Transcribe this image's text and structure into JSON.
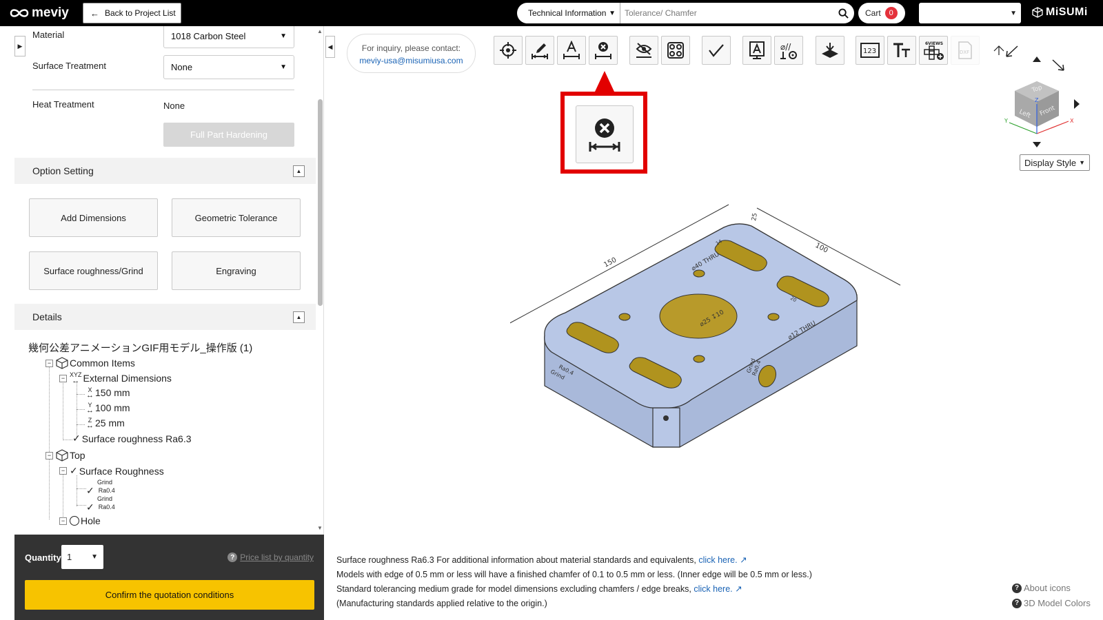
{
  "header": {
    "logo_text": "meviy",
    "back_label": "Back to Project List",
    "search_category": "Technical Information",
    "search_placeholder": "Tolerance/ Chamfer",
    "cart_label": "Cart",
    "cart_count": "0",
    "language_value": "",
    "brand": "MiSUMi"
  },
  "left_panel": {
    "material_label": "Material",
    "material_value": "1018 Carbon Steel",
    "surface_treatment_label": "Surface Treatment",
    "surface_treatment_value": "None",
    "heat_treatment_label": "Heat Treatment",
    "heat_treatment_value": "None",
    "full_part_hardening_label": "Full Part Hardening",
    "option_setting_title": "Option Setting",
    "option_buttons": [
      "Add Dimensions",
      "Geometric Tolerance",
      "Surface roughness/Grind",
      "Engraving"
    ],
    "details_title": "Details",
    "tree": {
      "root": "幾何公差アニメーションGIF用モデル_操作版 (1)",
      "common_items": "Common Items",
      "external_dimensions": "External Dimensions",
      "xyz_tag": "XYZ",
      "dim_x_axis": "X",
      "dim_x": "150 mm",
      "dim_y_axis": "Y",
      "dim_y": "100 mm",
      "dim_z_axis": "Z",
      "dim_z": "25 mm",
      "surface_roughness_common": "Surface roughness Ra6.3",
      "top": "Top",
      "surface_roughness": "Surface Roughness",
      "grind_1": "Grind",
      "ra_1": "Ra0.4",
      "grind_2": "Grind",
      "ra_2": "Ra0.4",
      "hole": "Hole"
    }
  },
  "bottom_left": {
    "quantity_label": "Quantity",
    "quantity_value": "1",
    "price_link": "Price list by quantity",
    "confirm_label": "Confirm the quotation conditions"
  },
  "viewer": {
    "contact_line1": "For inquiry, please contact:",
    "contact_email": "meviy-usa@misumiusa.com",
    "toolbar_icons": [
      "center-fit-icon",
      "edit-dimension-icon",
      "text-dimension-icon",
      "delete-dimension-icon",
      "hide-icon",
      "features-icon",
      "roughness-icon",
      "text-box-icon",
      "hole-tolerance-icon",
      "surface-icon",
      "numbering-icon",
      "text-size-icon",
      "six-views-icon",
      "dxf-icon"
    ],
    "six_views_label": "6VIEWS",
    "dxf_label": "DXF",
    "display_style_label": "Display Style",
    "cube_faces": [
      "Top",
      "Left",
      "Front"
    ],
    "axis_labels": [
      "X",
      "Y",
      "Z"
    ],
    "model_labels": {
      "dim_150": "150",
      "dim_100": "100",
      "dim_25": "25",
      "slot_len": "14",
      "slot_w": "20",
      "hole_40": "⌀40 THRU",
      "hole_12": "⌀12 THRU",
      "hole_center": "⌀25 ↧10",
      "grind_left": "Grind",
      "ra_left": "Ra0.4",
      "grind_right": "Grind",
      "ra_right": "Ra0.4"
    }
  },
  "footer": {
    "line1_text": "Surface roughness Ra6.3     For additional information about material standards and equivalents,",
    "line1_link": "click here.",
    "line2_text": "Models with edge of 0.5 mm or less will have a finished chamfer of 0.1 to 0.5 mm or less. (Inner edge will be 0.5 mm or less.)",
    "line3_text": "Standard tolerancing medium grade for model dimensions excluding chamfers / edge breaks,",
    "line3_link": "click here.",
    "line4_text": "(Manufacturing standards applied relative to the origin.)",
    "about_icons": "About icons",
    "model_colors": "3D Model Colors"
  },
  "colors": {
    "confirm_yellow": "#f7c300",
    "highlight_red": "#e20000",
    "model_blue": "#b6c6e6",
    "model_yellow": "#b89a2a",
    "link_blue": "#1a63b5"
  }
}
